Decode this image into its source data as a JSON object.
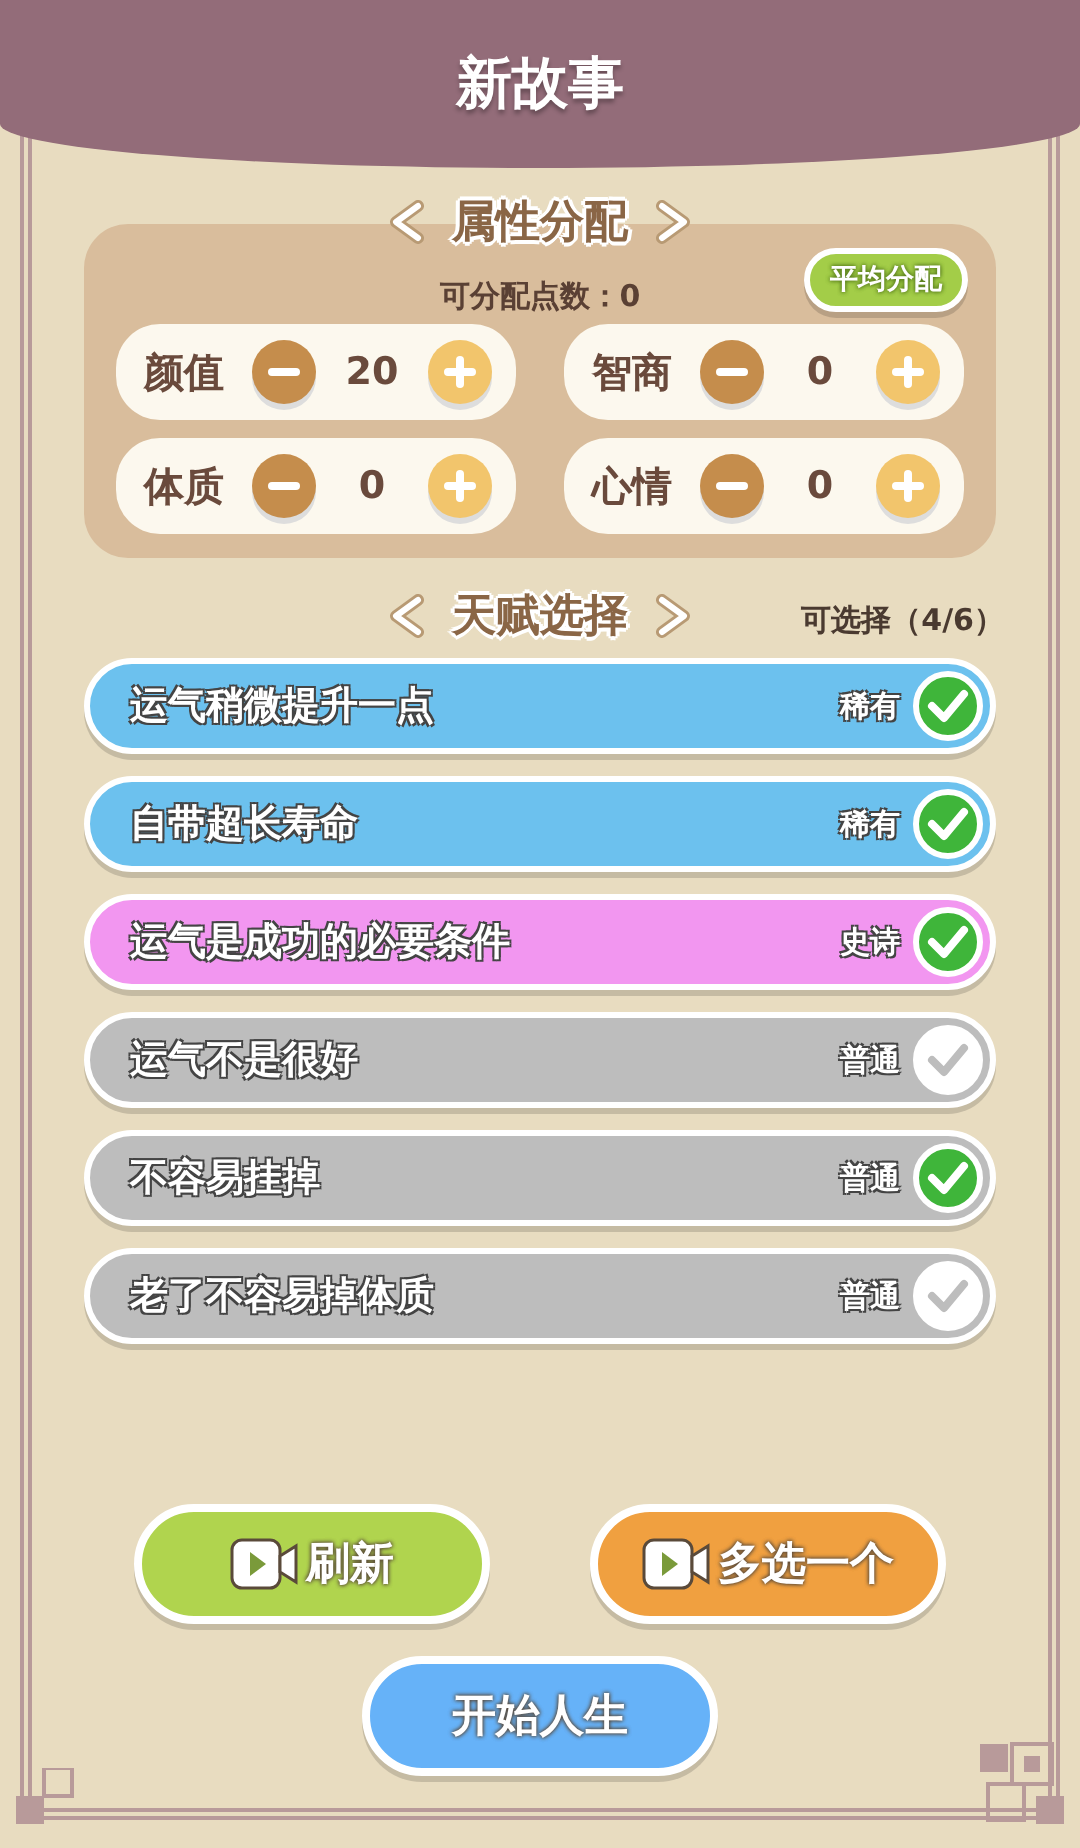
{
  "header": {
    "title": "新故事"
  },
  "attributes_section": {
    "title": "属性分配",
    "points_label": "可分配点数：0",
    "even_button": "平均分配",
    "attributes": [
      {
        "label": "颜值",
        "value": "20"
      },
      {
        "label": "智商",
        "value": "0"
      },
      {
        "label": "体质",
        "value": "0"
      },
      {
        "label": "心情",
        "value": "0"
      }
    ]
  },
  "talents_section": {
    "title": "天赋选择",
    "counter": "可选择（4/6）",
    "talents": [
      {
        "name": "运气稍微提升一点",
        "rarity": "稀有",
        "kind": "rare",
        "selected": true
      },
      {
        "name": "自带超长寿命",
        "rarity": "稀有",
        "kind": "rare",
        "selected": true
      },
      {
        "name": "运气是成功的必要条件",
        "rarity": "史诗",
        "kind": "epic",
        "selected": true
      },
      {
        "name": "运气不是很好",
        "rarity": "普通",
        "kind": "common",
        "selected": false
      },
      {
        "name": "不容易挂掉",
        "rarity": "普通",
        "kind": "common",
        "selected": true
      },
      {
        "name": "老了不容易掉体质",
        "rarity": "普通",
        "kind": "common",
        "selected": false
      }
    ]
  },
  "actions": {
    "refresh": "刷新",
    "extra_pick": "多选一个",
    "start": "开始人生"
  }
}
